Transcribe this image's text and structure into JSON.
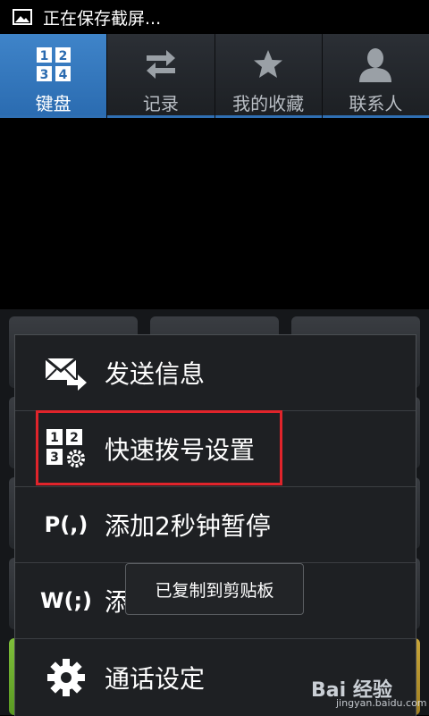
{
  "status_bar": {
    "text": "正在保存截屏..."
  },
  "tabs": [
    {
      "label": "键盘",
      "icon": "keypad-icon",
      "active": true
    },
    {
      "label": "记录",
      "icon": "swap-arrows-icon",
      "active": false
    },
    {
      "label": "我的收藏",
      "icon": "star-icon",
      "active": false
    },
    {
      "label": "联系人",
      "icon": "person-icon",
      "active": false
    }
  ],
  "menu": {
    "items": [
      {
        "label": "发送信息",
        "icon": "send-message-icon"
      },
      {
        "label": "快速拨号设置",
        "icon": "speed-dial-settings-icon",
        "highlighted": true
      },
      {
        "label": "添加2秒钟暂停",
        "icon": "pause-icon",
        "icon_text": "P(,)"
      },
      {
        "label": "添加等待",
        "icon": "wait-icon",
        "icon_text": "W(;)",
        "visible_label": "添"
      },
      {
        "label": "通话设定",
        "icon": "gear-icon"
      }
    ]
  },
  "toast": {
    "text": "已复制到剪贴板"
  },
  "watermark": {
    "logo": "Bai 经验",
    "url": "jingyan.baidu.com"
  },
  "colors": {
    "active_tab": "#2f76bd",
    "highlight_border": "#e0242b",
    "background": "#000000"
  }
}
